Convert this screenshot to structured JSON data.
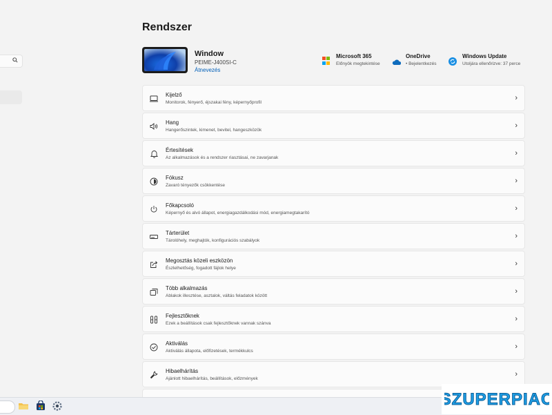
{
  "page_title": "Rendszer",
  "device": {
    "name": "Window",
    "model": "PEIME-J400SI-C",
    "rename_label": "Átnevezés"
  },
  "services": [
    {
      "name": "Microsoft 365",
      "sub": "Előnyök megtekintése",
      "icon": "microsoft-icon"
    },
    {
      "name": "OneDrive",
      "sub": "• Bejelentkezés",
      "icon": "onedrive-cloud-icon"
    },
    {
      "name": "Windows Update",
      "sub": "Utoljára ellenőrizve: 37 perce",
      "icon": "windows-update-icon"
    }
  ],
  "settings": [
    {
      "title": "Kijelző",
      "desc": "Monitorok, fényerő, éjszakai fény, képernyőprofil",
      "icon": "display-icon"
    },
    {
      "title": "Hang",
      "desc": "Hangerőszintek, kimenet, bevitel, hangeszközök",
      "icon": "speaker-icon"
    },
    {
      "title": "Értesítések",
      "desc": "Az alkalmazások és a rendszer riasztásai, ne zavarjanak",
      "icon": "bell-icon"
    },
    {
      "title": "Fókusz",
      "desc": "Zavaró tényezők csökkentése",
      "icon": "focus-icon"
    },
    {
      "title": "Főkapcsoló",
      "desc": "Képernyő és alvó állapot, energiagazdálkodási mód, energiamegtakarító",
      "icon": "power-icon"
    },
    {
      "title": "Tárterület",
      "desc": "Tárolóhely, meghajtók, konfigurációs szabályok",
      "icon": "storage-icon"
    },
    {
      "title": "Megosztás közeli eszközön",
      "desc": "Észlelhetőség, fogadott fájlok helye",
      "icon": "share-icon"
    },
    {
      "title": "Több alkalmazás",
      "desc": "Ablakok illesztése, asztalok, váltás feladatok között",
      "icon": "multitasking-icon"
    },
    {
      "title": "Fejlesztőknek",
      "desc": "Ezek a beállítások csak fejlesztőknek vannak szánva",
      "icon": "developer-tools-icon"
    },
    {
      "title": "Aktiválás",
      "desc": "Aktiválás állapota, előfizetések, termékkulcs",
      "icon": "checkmark-circle-icon"
    },
    {
      "title": "Hibaelhárítás",
      "desc": "Ajánlott hibaelhárítás, beállítások, előzmények",
      "icon": "wrench-icon"
    }
  ],
  "watermark": "SZUPERPIAC",
  "colors": {
    "accent": "#005fb8",
    "background": "#f3f3f3",
    "card": "#fbfbfb",
    "watermark": "#1e9fe6"
  }
}
